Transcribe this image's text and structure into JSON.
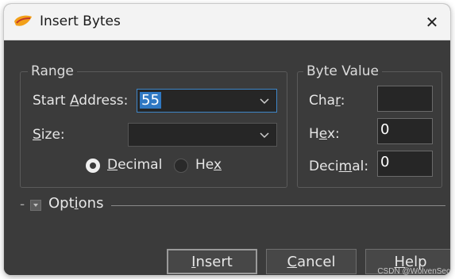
{
  "window": {
    "title": "Insert Bytes",
    "close_glyph": "✕"
  },
  "range": {
    "legend": "Range",
    "start_address": {
      "label_pre": "Start ",
      "label_key": "A",
      "label_post": "ddress:",
      "value": "55"
    },
    "size": {
      "label_key": "S",
      "label_post": "ize:",
      "value": ""
    },
    "format": {
      "decimal": {
        "label_key": "D",
        "label_post": "ecimal",
        "selected": true
      },
      "hex": {
        "label_pre": "He",
        "label_key": "x",
        "selected": false
      }
    }
  },
  "byte_value": {
    "legend": "Byte Value",
    "char": {
      "label_pre": "Cha",
      "label_key": "r",
      "label_post": ":",
      "value": ""
    },
    "hex": {
      "label_pre": "H",
      "label_key": "e",
      "label_post": "x:",
      "value": "0"
    },
    "decimal": {
      "label_pre": "Deci",
      "label_key": "m",
      "label_post": "al:",
      "value": "0"
    }
  },
  "options": {
    "dash": "-",
    "label_pre": "Opt",
    "label_key": "i",
    "label_post": "ons"
  },
  "buttons": {
    "insert": {
      "label_key": "I",
      "label_post": "nsert"
    },
    "cancel": {
      "label_key": "C",
      "label_post": "ancel"
    },
    "help": {
      "label_key": "H",
      "label_post": "elp"
    }
  },
  "watermark": "CSDN @WolvenSec"
}
